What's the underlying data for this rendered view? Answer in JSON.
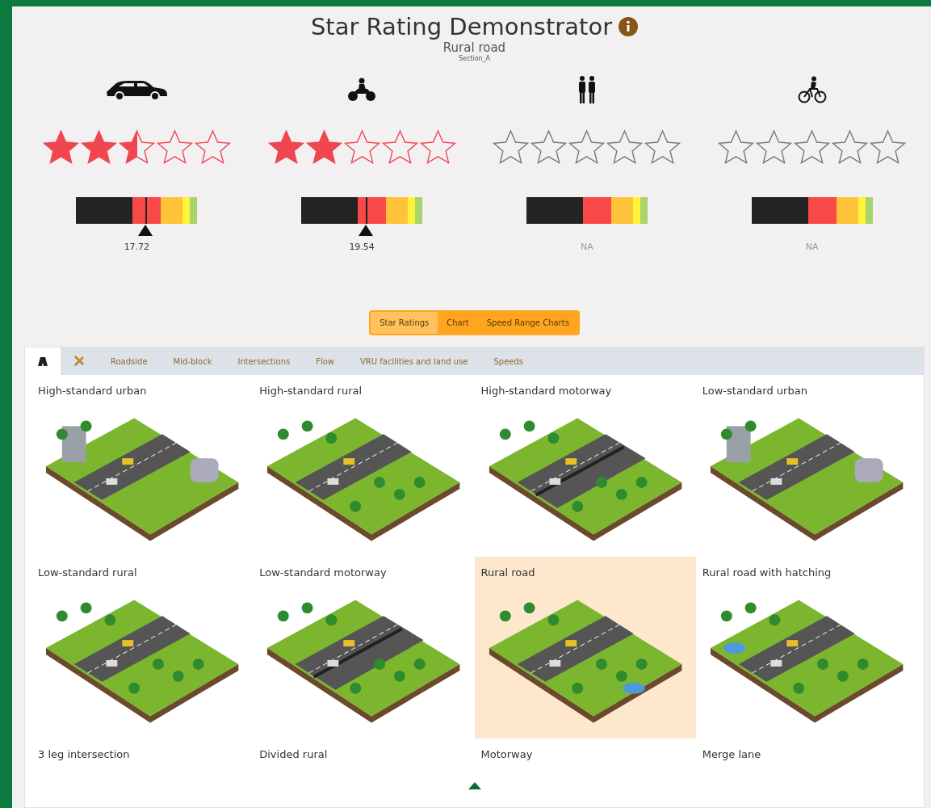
{
  "header": {
    "title": "Star Rating Demonstrator",
    "subtitle": "Rural road",
    "section": "Section_A"
  },
  "road_users": [
    {
      "kind": "car",
      "stars": 2.5,
      "level": 0.57,
      "reading": "17.72"
    },
    {
      "kind": "motorcycle",
      "stars": 2,
      "level": 0.53,
      "reading": "19.54"
    },
    {
      "kind": "pedestrian",
      "stars": 0,
      "reading": "NA"
    },
    {
      "kind": "bicycle",
      "stars": 0,
      "reading": "NA"
    }
  ],
  "view_toggle": [
    {
      "label": "Star Ratings",
      "selected": true
    },
    {
      "label": "Chart",
      "selected": false
    },
    {
      "label": "Speed Range Charts",
      "selected": false
    }
  ],
  "tabs": [
    {
      "kind": "road",
      "selected": true
    },
    {
      "kind": "tools",
      "selected": false
    },
    {
      "kind": "text",
      "label": "Roadside",
      "selected": false
    },
    {
      "kind": "text",
      "label": "Mid-block",
      "selected": false
    },
    {
      "kind": "text",
      "label": "Intersections",
      "selected": false
    },
    {
      "kind": "text",
      "label": "Flow",
      "selected": false
    },
    {
      "kind": "text",
      "label": "VRU facilities and land use",
      "selected": false
    },
    {
      "kind": "text",
      "label": "Speeds",
      "selected": false
    }
  ],
  "road_types": [
    {
      "label": "High-standard urban",
      "selected": false,
      "kind": "picture"
    },
    {
      "label": "High-standard rural",
      "selected": false,
      "kind": "picture"
    },
    {
      "label": "High-standard motorway",
      "selected": false,
      "kind": "picture"
    },
    {
      "label": "Low-standard urban",
      "selected": false,
      "kind": "picture"
    },
    {
      "label": "Low-standard rural",
      "selected": false,
      "kind": "picture"
    },
    {
      "label": "Low-standard motorway",
      "selected": false,
      "kind": "picture"
    },
    {
      "label": "Rural road",
      "selected": true,
      "kind": "picture"
    },
    {
      "label": "Rural road with hatching",
      "selected": false,
      "kind": "picture"
    },
    {
      "label": "3 leg intersection",
      "selected": false
    },
    {
      "label": "Divided rural",
      "selected": false
    },
    {
      "label": "Motorway",
      "selected": false
    },
    {
      "label": "Merge lane",
      "selected": false
    }
  ]
}
